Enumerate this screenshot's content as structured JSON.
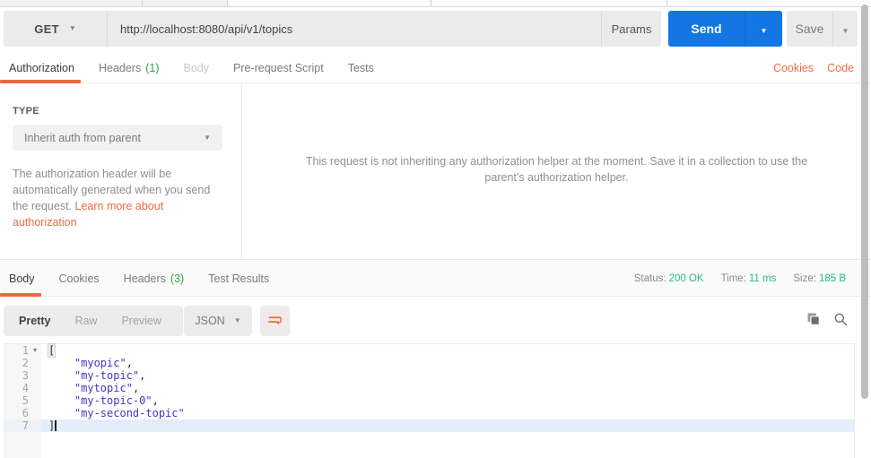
{
  "request_bar": {
    "method": "GET",
    "url": "http://localhost:8080/api/v1/topics",
    "params_label": "Params",
    "send_label": "Send",
    "save_label": "Save"
  },
  "request_tabs": {
    "tabs": [
      {
        "label": "Authorization",
        "active": true
      },
      {
        "label": "Headers",
        "count": "(1)"
      },
      {
        "label": "Body",
        "disabled": true
      },
      {
        "label": "Pre-request Script"
      },
      {
        "label": "Tests"
      }
    ],
    "cookies_label": "Cookies",
    "code_label": "Code"
  },
  "auth_panel": {
    "type_label": "TYPE",
    "type_value": "Inherit auth from parent",
    "description": "The authorization header will be automatically generated when you send the request. ",
    "link_text": "Learn more about authorization",
    "message": "This request is not inheriting any authorization helper at the moment. Save it in a collection to use the parent's authorization helper."
  },
  "response_panel": {
    "tabs": [
      {
        "label": "Body",
        "active": true
      },
      {
        "label": "Cookies"
      },
      {
        "label": "Headers",
        "count": "(3)"
      },
      {
        "label": "Test Results"
      }
    ],
    "meta": [
      {
        "label": "Status:",
        "value": "200 OK"
      },
      {
        "label": "Time:",
        "value": "11 ms"
      },
      {
        "label": "Size:",
        "value": "185 B"
      }
    ],
    "view_modes": [
      {
        "label": "Pretty",
        "active": true
      },
      {
        "label": "Raw"
      },
      {
        "label": "Preview"
      }
    ],
    "format": "JSON"
  },
  "editor": {
    "lines": [
      {
        "num": "1",
        "fold": true,
        "tokens": [
          {
            "text": "[",
            "type": "match"
          }
        ]
      },
      {
        "num": "2",
        "tokens": [
          {
            "text": "    ",
            "type": "plain"
          },
          {
            "text": "\"myopic\"",
            "type": "string"
          },
          {
            "text": ",",
            "type": "plain"
          }
        ]
      },
      {
        "num": "3",
        "tokens": [
          {
            "text": "    ",
            "type": "plain"
          },
          {
            "text": "\"my-topic\"",
            "type": "string"
          },
          {
            "text": ",",
            "type": "plain"
          }
        ]
      },
      {
        "num": "4",
        "tokens": [
          {
            "text": "    ",
            "type": "plain"
          },
          {
            "text": "\"mytopic\"",
            "type": "string"
          },
          {
            "text": ",",
            "type": "plain"
          }
        ]
      },
      {
        "num": "5",
        "tokens": [
          {
            "text": "    ",
            "type": "plain"
          },
          {
            "text": "\"my-topic-0\"",
            "type": "string"
          },
          {
            "text": ",",
            "type": "plain"
          }
        ]
      },
      {
        "num": "6",
        "tokens": [
          {
            "text": "    ",
            "type": "plain"
          },
          {
            "text": "\"my-second-topic\"",
            "type": "string"
          }
        ]
      },
      {
        "num": "7",
        "active": true,
        "cursor": true,
        "tokens": [
          {
            "text": "]",
            "type": "plain"
          }
        ]
      }
    ]
  },
  "colors": {
    "accent_orange": "#f2683c",
    "send_blue": "#1276e4",
    "count_green": "#2ca44e",
    "status_green": "#2abb82",
    "string_purple": "#4433cc"
  }
}
